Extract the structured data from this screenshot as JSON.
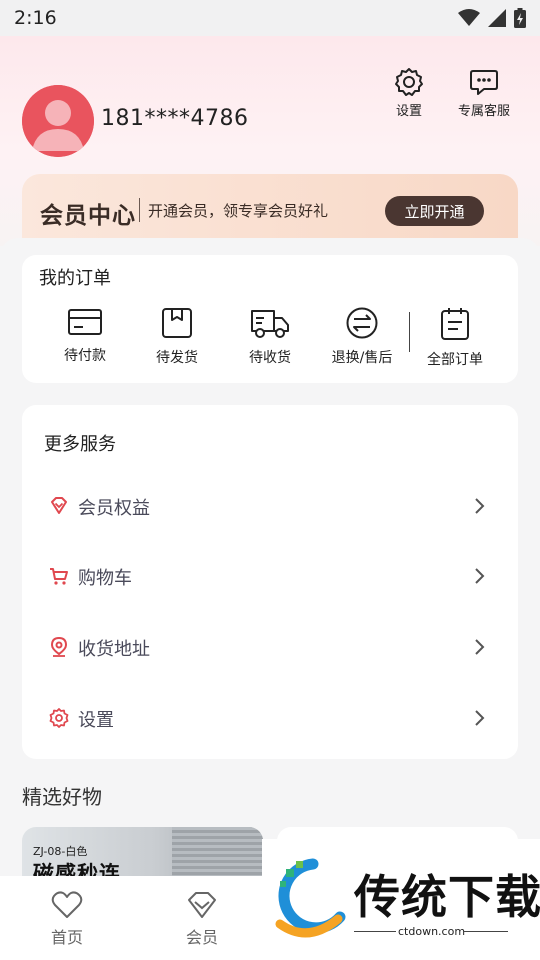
{
  "status_bar": {
    "time": "2:16"
  },
  "profile": {
    "phone": "181****4786"
  },
  "top_actions": {
    "settings_label": "设置",
    "service_label": "专属客服"
  },
  "vip_banner": {
    "title": "会员中心",
    "description": "开通会员，领专享会员好礼",
    "button_label": "立即开通"
  },
  "orders": {
    "title": "我的订单",
    "items": [
      {
        "label": "待付款",
        "icon": "wallet-card-icon"
      },
      {
        "label": "待发货",
        "icon": "package-box-icon"
      },
      {
        "label": "待收货",
        "icon": "delivery-truck-icon"
      },
      {
        "label": "退换/售后",
        "icon": "exchange-arrows-icon"
      },
      {
        "label": "全部订单",
        "icon": "order-list-icon"
      }
    ]
  },
  "services": {
    "title": "更多服务",
    "items": [
      {
        "label": "会员权益",
        "icon": "diamond-icon"
      },
      {
        "label": "购物车",
        "icon": "shopping-cart-icon"
      },
      {
        "label": "收货地址",
        "icon": "location-pin-icon"
      },
      {
        "label": "设置",
        "icon": "gear-icon"
      }
    ]
  },
  "featured": {
    "title": "精选好物",
    "product_left": {
      "sku": "ZJ-08-白色",
      "name": "磁感秒连"
    }
  },
  "tabs": [
    {
      "label": "首页",
      "icon": "heart-home-icon"
    },
    {
      "label": "会员",
      "icon": "diamond-tab-icon"
    }
  ],
  "watermark": {
    "text": "传统下载",
    "url": "ctdown.com"
  },
  "colors": {
    "accent_red": "#e0484f",
    "vip_button": "#4a3631",
    "vip_banner": "#f8d8c6"
  }
}
